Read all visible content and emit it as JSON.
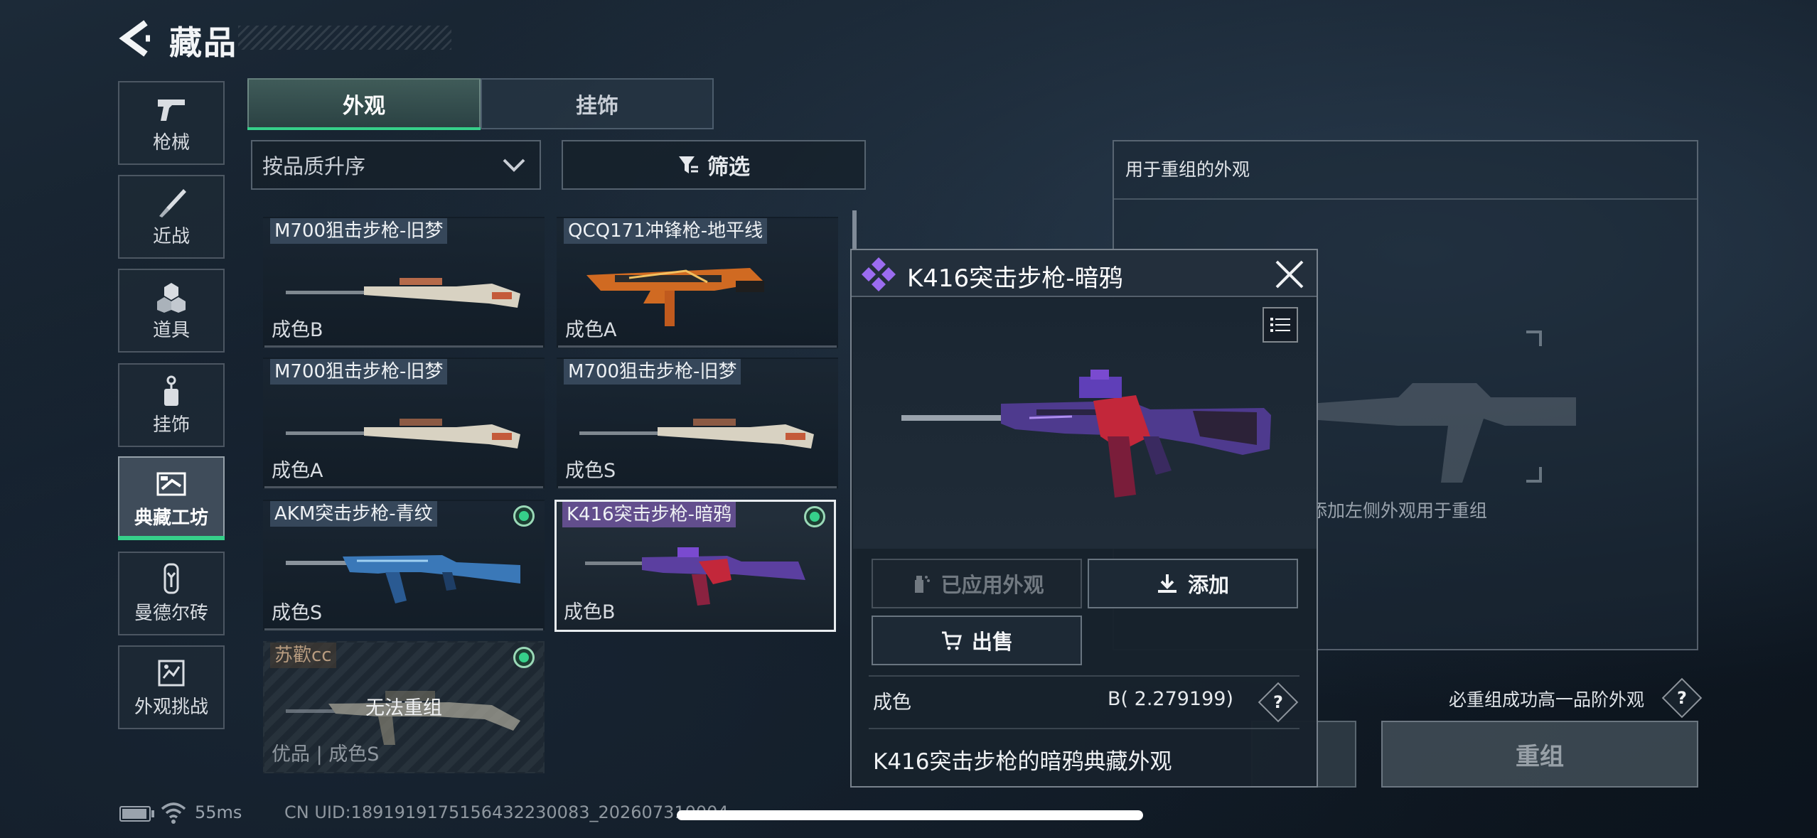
{
  "header": {
    "title": "藏品"
  },
  "sidebar": {
    "items": [
      {
        "label": "枪械",
        "icon": "pistol-icon"
      },
      {
        "label": "近战",
        "icon": "knife-icon"
      },
      {
        "label": "道具",
        "icon": "grenade-icon"
      },
      {
        "label": "挂饰",
        "icon": "charm-icon"
      },
      {
        "label": "典藏工坊",
        "icon": "workshop-icon",
        "active": true
      },
      {
        "label": "曼德尔砖",
        "icon": "brick-icon"
      },
      {
        "label": "外观挑战",
        "icon": "challenge-icon"
      }
    ]
  },
  "tabs": [
    {
      "label": "外观",
      "active": true
    },
    {
      "label": "挂饰",
      "active": false
    }
  ],
  "sort": {
    "value": "按品质升序"
  },
  "filter": {
    "label": "筛选"
  },
  "items": [
    {
      "name": "M700狙击步枪-旧梦",
      "grade": "成色B",
      "equipped": false
    },
    {
      "name": "QCQ171冲锋枪-地平线",
      "grade": "成色A",
      "equipped": false
    },
    {
      "name": "M700狙击步枪-旧梦",
      "grade": "成色A",
      "equipped": false
    },
    {
      "name": "M700狙击步枪-旧梦",
      "grade": "成色S",
      "equipped": false
    },
    {
      "name": "AKM突击步枪-青纹",
      "grade": "成色S",
      "equipped": true
    },
    {
      "name": "K416突击步枪-暗鸦",
      "grade": "成色B",
      "equipped": true,
      "selected": true
    },
    {
      "name": "苏歡cc",
      "grade": "优品 | 成色S",
      "equipped": true,
      "locked": true,
      "lock_text": "无法重组"
    }
  ],
  "recombine": {
    "header": "用于重组的外观",
    "hint": "添加左侧外观用于重组",
    "requirement": "必重组成功高一品阶外观",
    "button": "重组",
    "help": "?"
  },
  "detail": {
    "title": "K416突击步枪-暗鸦",
    "applied_label": "已应用外观",
    "add_label": "添加",
    "sell_label": "出售",
    "grade_label": "成色",
    "grade_value": "B( 2.279199)",
    "help": "?",
    "description": "K416突击步枪的暗鸦典藏外观"
  },
  "status": {
    "ping": "55ms",
    "uid": "CN UID:1891919175156432230083_202607310004"
  },
  "colors": {
    "accent_green": "#36d08a",
    "rarity_purple": "#9b6cf0",
    "background": "#111b26"
  }
}
